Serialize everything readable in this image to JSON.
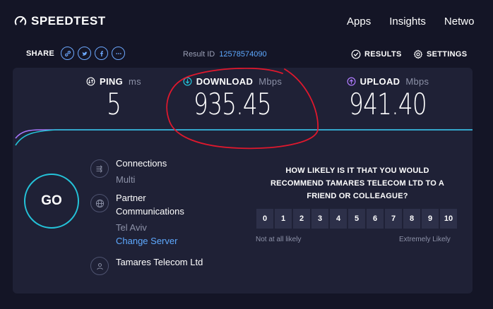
{
  "header": {
    "logo_text": "SPEEDTEST",
    "nav": [
      "Apps",
      "Insights",
      "Netwo"
    ]
  },
  "share": {
    "label": "SHARE",
    "icons": [
      "link-icon",
      "twitter-icon",
      "facebook-icon",
      "more-icon"
    ]
  },
  "result": {
    "label": "Result ID",
    "id": "12578574090"
  },
  "links": {
    "results": "RESULTS",
    "settings": "SETTINGS"
  },
  "metrics": {
    "ping": {
      "label": "PING",
      "unit": "ms",
      "value": "5"
    },
    "download": {
      "label": "DOWNLOAD",
      "unit": "Mbps",
      "value": "935.45"
    },
    "upload": {
      "label": "UPLOAD",
      "unit": "Mbps",
      "value": "941.40"
    }
  },
  "go_label": "GO",
  "server": {
    "connections_label": "Connections",
    "connections_value": "Multi",
    "host_name_line1": "Partner",
    "host_name_line2": "Communications",
    "host_location": "Tel Aviv",
    "change_server": "Change Server",
    "isp": "Tamares Telecom Ltd"
  },
  "survey": {
    "question": "HOW LIKELY IS IT THAT YOU WOULD RECOMMEND TAMARES TELECOM LTD TO A FRIEND OR COLLEAGUE?",
    "scale": [
      "0",
      "1",
      "2",
      "3",
      "4",
      "5",
      "6",
      "7",
      "8",
      "9",
      "10"
    ],
    "low_label": "Not at all likely",
    "high_label": "Extremely Likely"
  },
  "colors": {
    "background": "#141526",
    "card": "#1f2136",
    "accent_cyan": "#24c3d9",
    "link_blue": "#5ea9ff",
    "upload_purple": "#b07cff",
    "annotation_red": "#e0182d"
  }
}
